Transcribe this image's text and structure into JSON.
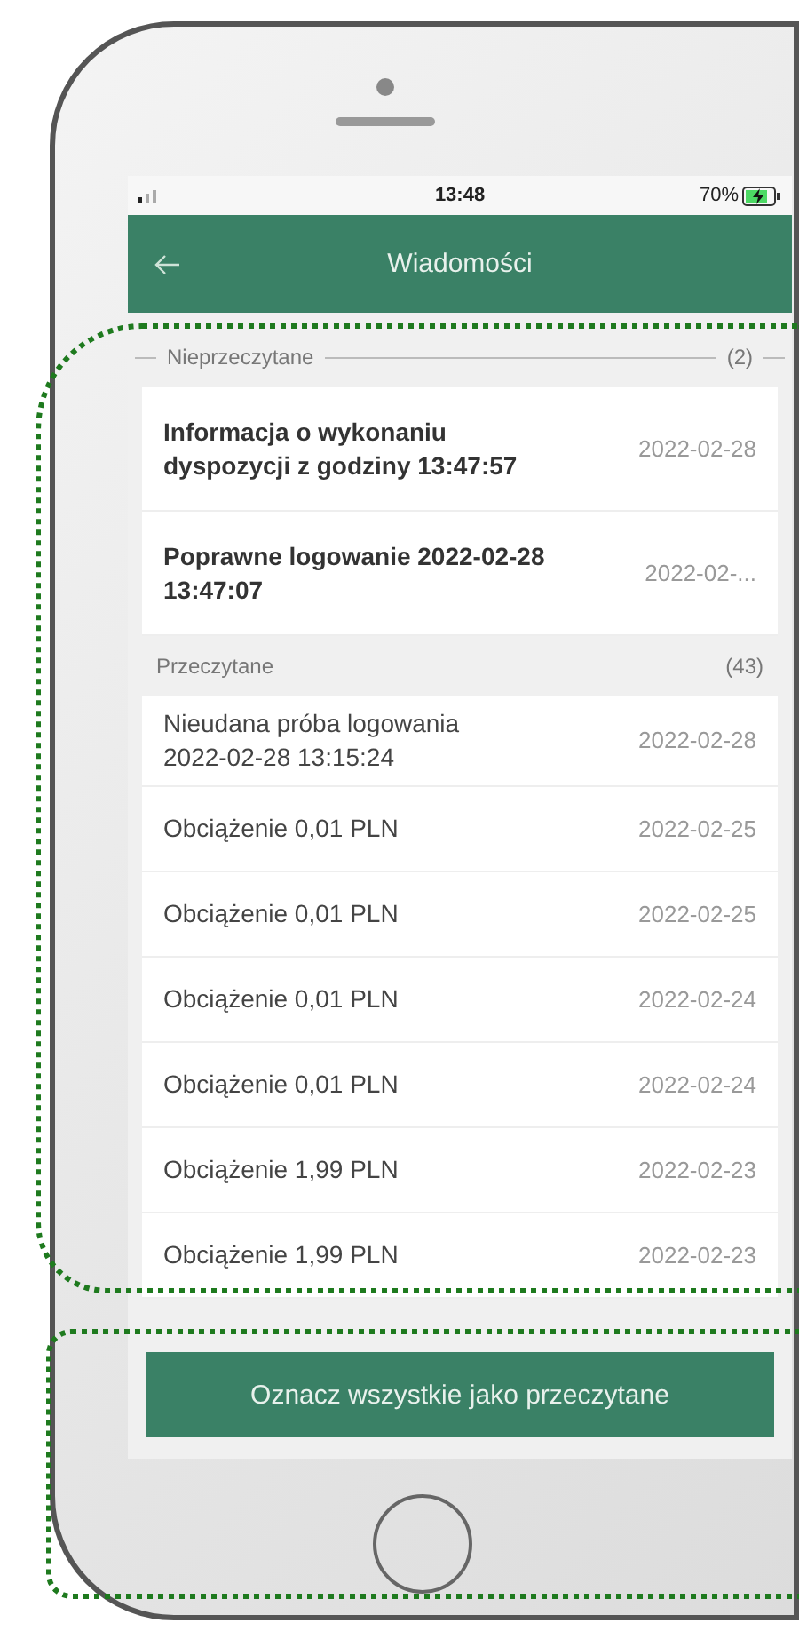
{
  "status_bar": {
    "time": "13:48",
    "battery": "70%"
  },
  "header": {
    "title": "Wiadomości"
  },
  "sections": [
    {
      "kind": "unread",
      "title": "Nieprzeczytane",
      "count": "(2)",
      "messages": [
        {
          "title": "Informacja o wykonaniu dyspozycji z godziny 13:47:57",
          "date": "2022-02-28"
        },
        {
          "title": "Poprawne logowanie 2022-02-28 13:47:07",
          "date": "2022-02-..."
        }
      ]
    },
    {
      "kind": "read",
      "title": "Przeczytane",
      "count": "(43)",
      "messages": [
        {
          "title": "Nieudana próba logowania 2022-02-28 13:15:24",
          "date": "2022-02-28"
        },
        {
          "title": "Obciążenie 0,01 PLN",
          "date": "2022-02-25"
        },
        {
          "title": "Obciążenie 0,01 PLN",
          "date": "2022-02-25"
        },
        {
          "title": "Obciążenie 0,01 PLN",
          "date": "2022-02-24"
        },
        {
          "title": "Obciążenie 0,01 PLN",
          "date": "2022-02-24"
        },
        {
          "title": "Obciążenie 1,99 PLN",
          "date": "2022-02-23"
        },
        {
          "title": "Obciążenie 1,99 PLN",
          "date": "2022-02-23"
        }
      ]
    }
  ],
  "action_button": "Oznacz wszystkie jako przeczytane"
}
